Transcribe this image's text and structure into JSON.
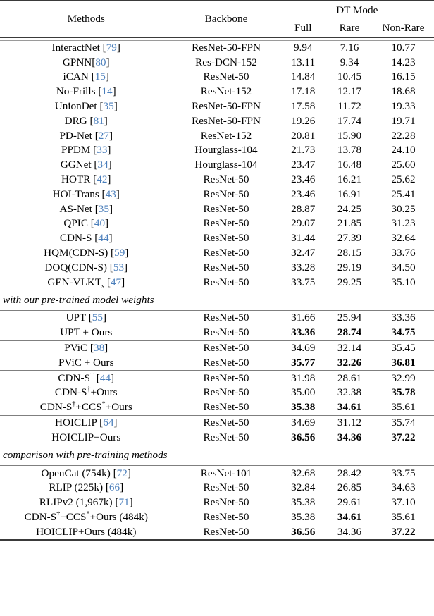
{
  "table": {
    "columns": {
      "methods": "Methods",
      "backbone": "Backbone",
      "group_header": "DT Mode",
      "full": "Full",
      "rare": "Rare",
      "non_rare": "Non-Rare"
    },
    "cite_color": "#4a7ebb",
    "sections": [
      {
        "label": null,
        "rows": [
          {
            "method": "InteractNet",
            "cite": "79",
            "cite_space": true,
            "backbone": "ResNet-50-FPN",
            "full": "9.94",
            "rare": "7.16",
            "non_rare": "10.77",
            "bold": []
          },
          {
            "method": "GPNN",
            "cite": "80",
            "cite_space": false,
            "backbone": "Res-DCN-152",
            "full": "13.11",
            "rare": "9.34",
            "non_rare": "14.23",
            "bold": []
          },
          {
            "method": "iCAN",
            "cite": "15",
            "cite_space": true,
            "backbone": "ResNet-50",
            "full": "14.84",
            "rare": "10.45",
            "non_rare": "16.15",
            "bold": []
          },
          {
            "method": "No-Frills",
            "cite": "14",
            "cite_space": true,
            "backbone": "ResNet-152",
            "full": "17.18",
            "rare": "12.17",
            "non_rare": "18.68",
            "bold": []
          },
          {
            "method": "UnionDet",
            "cite": "35",
            "cite_space": true,
            "backbone": "ResNet-50-FPN",
            "full": "17.58",
            "rare": "11.72",
            "non_rare": "19.33",
            "bold": []
          },
          {
            "method": "DRG",
            "cite": "81",
            "cite_space": true,
            "backbone": "ResNet-50-FPN",
            "full": "19.26",
            "rare": "17.74",
            "non_rare": "19.71",
            "bold": []
          },
          {
            "method": "PD-Net",
            "cite": "27",
            "cite_space": true,
            "backbone": "ResNet-152",
            "full": "20.81",
            "rare": "15.90",
            "non_rare": "22.28",
            "bold": []
          },
          {
            "method": "PPDM",
            "cite": "33",
            "cite_space": true,
            "backbone": "Hourglass-104",
            "full": "21.73",
            "rare": "13.78",
            "non_rare": "24.10",
            "bold": []
          },
          {
            "method": "GGNet",
            "cite": "34",
            "cite_space": true,
            "backbone": "Hourglass-104",
            "full": "23.47",
            "rare": "16.48",
            "non_rare": "25.60",
            "bold": []
          },
          {
            "method": "HOTR",
            "cite": "42",
            "cite_space": true,
            "backbone": "ResNet-50",
            "full": "23.46",
            "rare": "16.21",
            "non_rare": "25.62",
            "bold": []
          },
          {
            "method": "HOI-Trans",
            "cite": "43",
            "cite_space": true,
            "backbone": "ResNet-50",
            "full": "23.46",
            "rare": "16.91",
            "non_rare": "25.41",
            "bold": []
          },
          {
            "method": "AS-Net",
            "cite": "35",
            "cite_space": true,
            "backbone": "ResNet-50",
            "full": "28.87",
            "rare": "24.25",
            "non_rare": "30.25",
            "bold": []
          },
          {
            "method": "QPIC",
            "cite": "40",
            "cite_space": true,
            "backbone": "ResNet-50",
            "full": "29.07",
            "rare": "21.85",
            "non_rare": "31.23",
            "bold": []
          },
          {
            "method": "CDN-S",
            "cite": "44",
            "cite_space": true,
            "backbone": "ResNet-50",
            "full": "31.44",
            "rare": "27.39",
            "non_rare": "32.64",
            "bold": []
          },
          {
            "method": "HQM(CDN-S)",
            "cite": "59",
            "cite_space": true,
            "backbone": "ResNet-50",
            "full": "32.47",
            "rare": "28.15",
            "non_rare": "33.76",
            "bold": []
          },
          {
            "method": "DOQ(CDN-S)",
            "cite": "53",
            "cite_space": true,
            "backbone": "ResNet-50",
            "full": "33.28",
            "rare": "29.19",
            "non_rare": "34.50",
            "bold": []
          },
          {
            "method": "GEN-VLKT",
            "method_sub": "s",
            "cite": "47",
            "cite_space": true,
            "backbone": "ResNet-50",
            "full": "33.75",
            "rare": "29.25",
            "non_rare": "35.10",
            "bold": []
          }
        ]
      },
      {
        "label": "with our pre-trained model weights",
        "groups": [
          {
            "rows": [
              {
                "method": "UPT",
                "cite": "55",
                "cite_space": true,
                "backbone": "ResNet-50",
                "full": "31.66",
                "rare": "25.94",
                "non_rare": "33.36",
                "bold": []
              },
              {
                "method": "UPT + Ours",
                "cite": null,
                "backbone": "ResNet-50",
                "full": "33.36",
                "rare": "28.74",
                "non_rare": "34.75",
                "bold": [
                  "full",
                  "rare",
                  "non_rare"
                ]
              }
            ]
          },
          {
            "rows": [
              {
                "method": "PViC",
                "cite": "38",
                "cite_space": true,
                "backbone": "ResNet-50",
                "full": "34.69",
                "rare": "32.14",
                "non_rare": "35.45",
                "bold": []
              },
              {
                "method": "PViC + Ours",
                "cite": null,
                "backbone": "ResNet-50",
                "full": "35.77",
                "rare": "32.26",
                "non_rare": "36.81",
                "bold": [
                  "full",
                  "rare",
                  "non_rare"
                ]
              }
            ]
          },
          {
            "rows": [
              {
                "method": "CDN-S",
                "method_sup": "†",
                "cite": "44",
                "cite_space": true,
                "backbone": "ResNet-50",
                "full": "31.98",
                "rare": "28.61",
                "non_rare": "32.99",
                "bold": []
              },
              {
                "method_parts": [
                  {
                    "t": "CDN-S"
                  },
                  {
                    "t": "†",
                    "sup": true
                  },
                  {
                    "t": "+Ours"
                  }
                ],
                "cite": null,
                "backbone": "ResNet-50",
                "full": "35.00",
                "rare": "32.38",
                "non_rare": "35.78",
                "bold": [
                  "non_rare"
                ]
              },
              {
                "method_parts": [
                  {
                    "t": "CDN-S"
                  },
                  {
                    "t": "†",
                    "sup": true
                  },
                  {
                    "t": "+CCS"
                  },
                  {
                    "t": "*",
                    "sup": true
                  },
                  {
                    "t": "+Ours"
                  }
                ],
                "cite": null,
                "backbone": "ResNet-50",
                "full": "35.38",
                "rare": "34.61",
                "non_rare": "35.61",
                "bold": [
                  "full",
                  "rare"
                ]
              }
            ]
          },
          {
            "rows": [
              {
                "method": "HOICLIP",
                "cite": "64",
                "cite_space": true,
                "backbone": "ResNet-50",
                "full": "34.69",
                "rare": "31.12",
                "non_rare": "35.74",
                "bold": []
              },
              {
                "method": "HOICLIP+Ours",
                "cite": null,
                "backbone": "ResNet-50",
                "full": "36.56",
                "rare": "34.36",
                "non_rare": "37.22",
                "bold": [
                  "full",
                  "rare",
                  "non_rare"
                ]
              }
            ]
          }
        ]
      },
      {
        "label": "comparison with pre-training methods",
        "groups": [
          {
            "rows": [
              {
                "method": "OpenCat (754k)",
                "cite": "72",
                "cite_space": true,
                "backbone": "ResNet-101",
                "full": "32.68",
                "rare": "28.42",
                "non_rare": "33.75",
                "bold": []
              },
              {
                "method": "RLIP (225k)",
                "cite": "66",
                "cite_space": true,
                "backbone": "ResNet-50",
                "full": "32.84",
                "rare": "26.85",
                "non_rare": "34.63",
                "bold": []
              },
              {
                "method": "RLIPv2 (1,967k)",
                "cite": "71",
                "cite_space": true,
                "backbone": "ResNet-50",
                "full": "35.38",
                "rare": "29.61",
                "non_rare": "37.10",
                "bold": []
              },
              {
                "method_parts": [
                  {
                    "t": "CDN-S"
                  },
                  {
                    "t": "†",
                    "sup": true
                  },
                  {
                    "t": "+CCS"
                  },
                  {
                    "t": "*",
                    "sup": true
                  },
                  {
                    "t": "+Ours (484k)"
                  }
                ],
                "cite": null,
                "backbone": "ResNet-50",
                "full": "35.38",
                "rare": "34.61",
                "non_rare": "35.61",
                "bold": [
                  "rare"
                ]
              },
              {
                "method": "HOICLIP+Ours (484k)",
                "cite": null,
                "backbone": "ResNet-50",
                "full": "36.56",
                "rare": "34.36",
                "non_rare": "37.22",
                "bold": [
                  "full",
                  "non_rare"
                ]
              }
            ]
          }
        ]
      }
    ]
  },
  "chart_data": {
    "type": "table",
    "title": "HOI detection results under DT Mode",
    "columns": [
      "Methods",
      "Backbone",
      "Full",
      "Rare",
      "Non-Rare"
    ],
    "rows": [
      [
        "InteractNet [79]",
        "ResNet-50-FPN",
        9.94,
        7.16,
        10.77
      ],
      [
        "GPNN[80]",
        "Res-DCN-152",
        13.11,
        9.34,
        14.23
      ],
      [
        "iCAN [15]",
        "ResNet-50",
        14.84,
        10.45,
        16.15
      ],
      [
        "No-Frills [14]",
        "ResNet-152",
        17.18,
        12.17,
        18.68
      ],
      [
        "UnionDet [35]",
        "ResNet-50-FPN",
        17.58,
        11.72,
        19.33
      ],
      [
        "DRG [81]",
        "ResNet-50-FPN",
        19.26,
        17.74,
        19.71
      ],
      [
        "PD-Net [27]",
        "ResNet-152",
        20.81,
        15.9,
        22.28
      ],
      [
        "PPDM [33]",
        "Hourglass-104",
        21.73,
        13.78,
        24.1
      ],
      [
        "GGNet [34]",
        "Hourglass-104",
        23.47,
        16.48,
        25.6
      ],
      [
        "HOTR [42]",
        "ResNet-50",
        23.46,
        16.21,
        25.62
      ],
      [
        "HOI-Trans [43]",
        "ResNet-50",
        23.46,
        16.91,
        25.41
      ],
      [
        "AS-Net [35]",
        "ResNet-50",
        28.87,
        24.25,
        30.25
      ],
      [
        "QPIC [40]",
        "ResNet-50",
        29.07,
        21.85,
        31.23
      ],
      [
        "CDN-S [44]",
        "ResNet-50",
        31.44,
        27.39,
        32.64
      ],
      [
        "HQM(CDN-S) [59]",
        "ResNet-50",
        32.47,
        28.15,
        33.76
      ],
      [
        "DOQ(CDN-S) [53]",
        "ResNet-50",
        33.28,
        29.19,
        34.5
      ],
      [
        "GEN-VLKTs [47]",
        "ResNet-50",
        33.75,
        29.25,
        35.1
      ],
      [
        "UPT [55]",
        "ResNet-50",
        31.66,
        25.94,
        33.36
      ],
      [
        "UPT + Ours",
        "ResNet-50",
        33.36,
        28.74,
        34.75
      ],
      [
        "PViC [38]",
        "ResNet-50",
        34.69,
        32.14,
        35.45
      ],
      [
        "PViC + Ours",
        "ResNet-50",
        35.77,
        32.26,
        36.81
      ],
      [
        "CDN-S† [44]",
        "ResNet-50",
        31.98,
        28.61,
        32.99
      ],
      [
        "CDN-S†+Ours",
        "ResNet-50",
        35.0,
        32.38,
        35.78
      ],
      [
        "CDN-S†+CCS*+Ours",
        "ResNet-50",
        35.38,
        34.61,
        35.61
      ],
      [
        "HOICLIP [64]",
        "ResNet-50",
        34.69,
        31.12,
        35.74
      ],
      [
        "HOICLIP+Ours",
        "ResNet-50",
        36.56,
        34.36,
        37.22
      ],
      [
        "OpenCat (754k) [72]",
        "ResNet-101",
        32.68,
        28.42,
        33.75
      ],
      [
        "RLIP (225k) [66]",
        "ResNet-50",
        32.84,
        26.85,
        34.63
      ],
      [
        "RLIPv2 (1,967k) [71]",
        "ResNet-50",
        35.38,
        29.61,
        37.1
      ],
      [
        "CDN-S†+CCS*+Ours (484k)",
        "ResNet-50",
        35.38,
        34.61,
        35.61
      ],
      [
        "HOICLIP+Ours (484k)",
        "ResNet-50",
        36.56,
        34.36,
        37.22
      ]
    ]
  }
}
